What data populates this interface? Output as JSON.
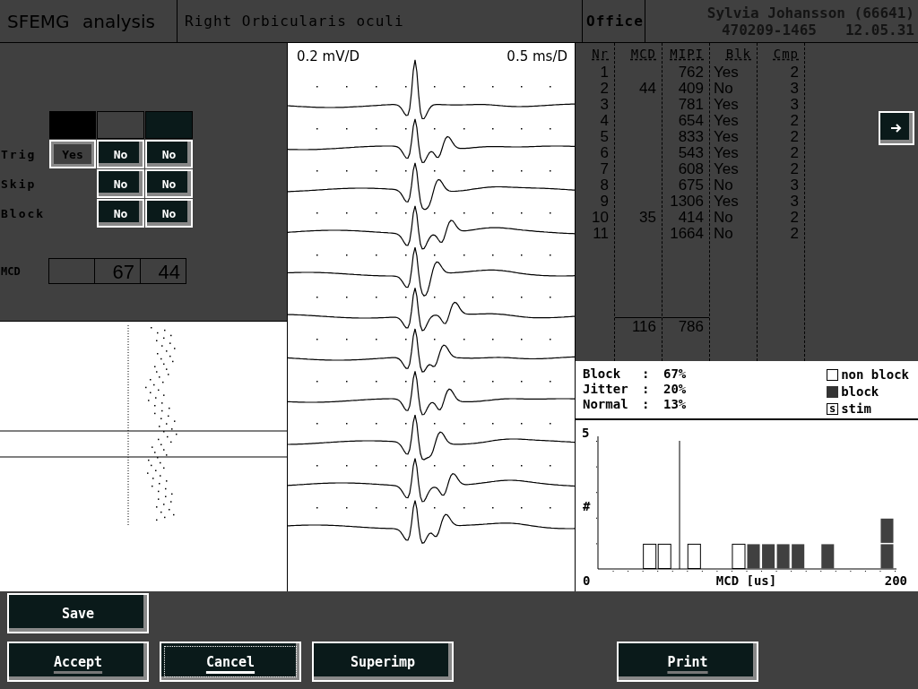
{
  "header": {
    "title": "SFEMG analysis",
    "muscle": "Right Orbicularis oculi",
    "location": "Office",
    "patient": "Sylvia Johansson (66641)",
    "patient_id": "470209-1465",
    "time": "12.05.31"
  },
  "controls": {
    "swatches": [
      {
        "color": "#000000"
      },
      {
        "color": "#404040"
      },
      {
        "color": "#0a1a1a"
      }
    ],
    "toggles": [
      {
        "label": "Trig",
        "cells": [
          {
            "text": "Yes",
            "selected": true
          },
          {
            "text": "No",
            "selected": false
          },
          {
            "text": "No",
            "selected": false
          }
        ]
      },
      {
        "label": "Skip",
        "cells": [
          {
            "text": "No",
            "selected": false
          },
          {
            "text": "No",
            "selected": false
          }
        ]
      },
      {
        "label": "Block",
        "cells": [
          {
            "text": "No",
            "selected": false
          },
          {
            "text": "No",
            "selected": false
          }
        ]
      }
    ],
    "mcd": {
      "label": "MCD",
      "values": [
        "67",
        "44"
      ]
    }
  },
  "traces": {
    "gain": "0.2 mV/D",
    "sweep": "0.5 ms/D"
  },
  "table": {
    "columns": [
      "Nr",
      "MCD",
      "MIPI",
      "Blk",
      "Cmp"
    ],
    "rows": [
      [
        "1",
        "",
        "762",
        "Yes",
        "2"
      ],
      [
        "2",
        "44",
        "409",
        "No",
        "3"
      ],
      [
        "3",
        "",
        "781",
        "Yes",
        "3"
      ],
      [
        "4",
        "",
        "654",
        "Yes",
        "2"
      ],
      [
        "5",
        "",
        "833",
        "Yes",
        "2"
      ],
      [
        "6",
        "",
        "543",
        "Yes",
        "2"
      ],
      [
        "7",
        "",
        "608",
        "Yes",
        "2"
      ],
      [
        "8",
        "",
        "675",
        "No",
        "3"
      ],
      [
        "9",
        "",
        "1306",
        "Yes",
        "3"
      ],
      [
        "10",
        "35",
        "414",
        "No",
        "2"
      ],
      [
        "11",
        "",
        "1664",
        "No",
        "2"
      ]
    ],
    "totals": {
      "mcd": "116",
      "mipi": "786"
    }
  },
  "stats": [
    {
      "label": "Block",
      "separator": ":",
      "value": "67%"
    },
    {
      "label": "Jitter",
      "separator": ":",
      "value": "20%"
    },
    {
      "label": "Normal",
      "separator": ":",
      "value": "13%"
    }
  ],
  "legend": [
    {
      "kind": "open",
      "label": "non block"
    },
    {
      "kind": "filled",
      "label": "block"
    },
    {
      "kind": "stim",
      "symbol": "s",
      "label": "stim"
    }
  ],
  "histogram": {
    "y_top_label": "5",
    "y_label": "#",
    "x_min_label": "0",
    "x_label": "MCD [us]",
    "x_max_label": "200"
  },
  "buttons": [
    {
      "label": "Save",
      "underlined": false,
      "focused": false
    },
    {
      "label": "Accept",
      "underlined": true,
      "focused": false
    },
    {
      "label": "Cancel",
      "underlined": true,
      "focused": true
    },
    {
      "label": "Superimp",
      "underlined": false,
      "focused": false
    },
    {
      "label": "Print",
      "underlined": true,
      "focused": false
    }
  ]
}
